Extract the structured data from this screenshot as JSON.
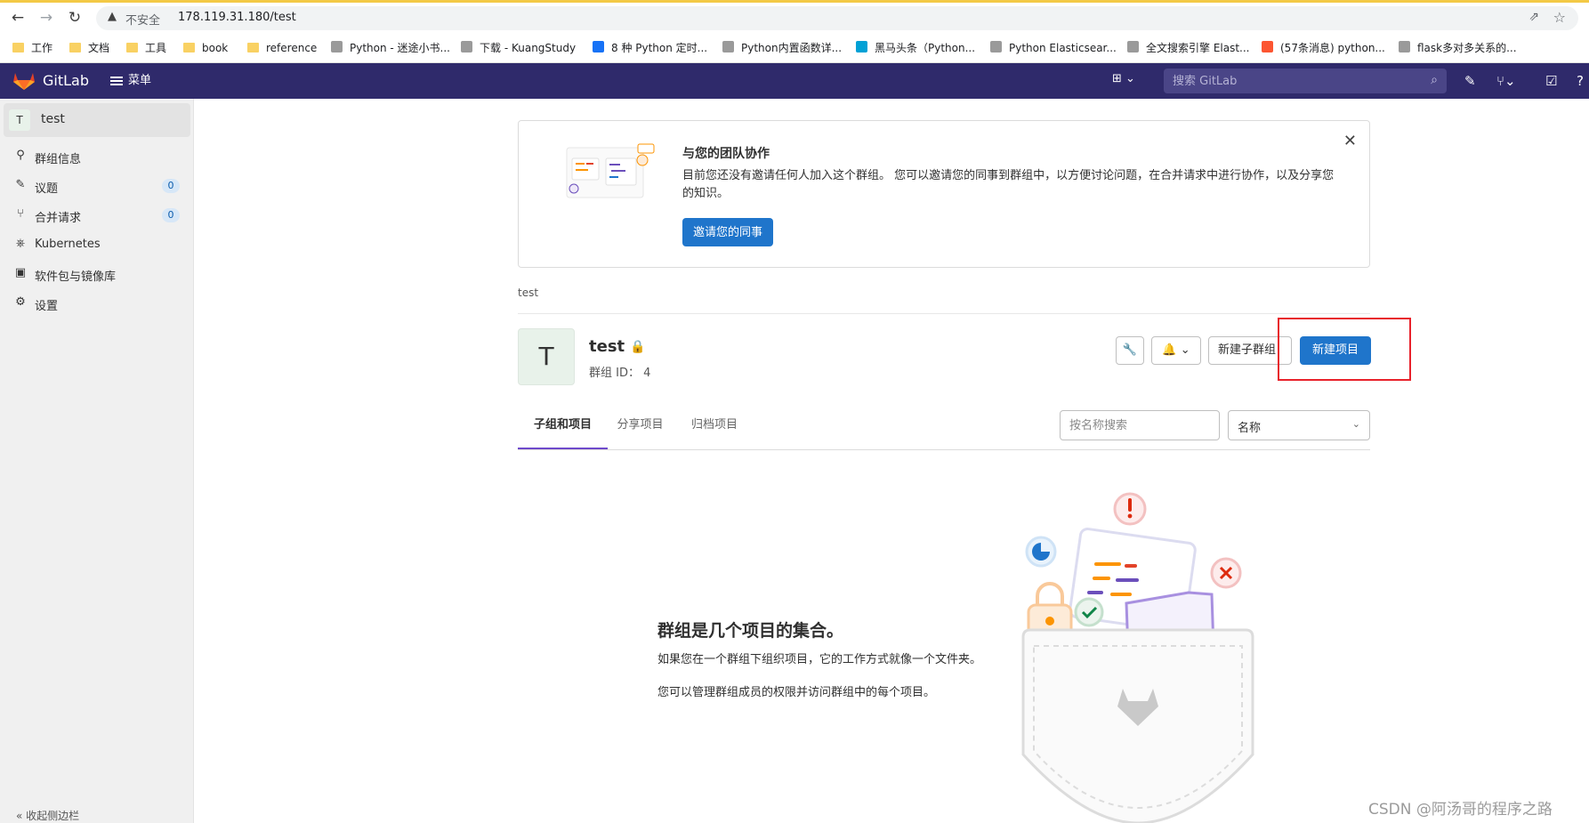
{
  "browser": {
    "security_label": "不安全",
    "url": "178.119.31.180/test",
    "bookmarks": [
      {
        "label": "工作",
        "icon": "folder-icon"
      },
      {
        "label": "文档",
        "icon": "folder-icon"
      },
      {
        "label": "工具",
        "icon": "folder-icon"
      },
      {
        "label": "book",
        "icon": "folder-icon"
      },
      {
        "label": "reference",
        "icon": "folder-icon"
      },
      {
        "label": "Python - 迷途小书...",
        "icon": "site-icon"
      },
      {
        "label": "下载 - KuangStudy",
        "icon": "site-icon"
      },
      {
        "label": "8 种 Python 定时...",
        "icon": "zhihu-icon"
      },
      {
        "label": "Python内置函数详...",
        "icon": "site-icon"
      },
      {
        "label": "黑马头条（Python...",
        "icon": "bilibili-icon"
      },
      {
        "label": "Python Elasticsear...",
        "icon": "site-icon"
      },
      {
        "label": "全文搜索引擎 Elast...",
        "icon": "site-icon"
      },
      {
        "label": "(57条消息) python...",
        "icon": "csdn-icon"
      },
      {
        "label": "flask多对多关系的...",
        "icon": "site-icon"
      }
    ]
  },
  "header": {
    "brand": "GitLab",
    "menu_label": "菜单",
    "search_placeholder": "搜索 GitLab"
  },
  "sidebar": {
    "context_avatar": "T",
    "context_name": "test",
    "items": [
      {
        "label": "群组信息",
        "icon": "group-info-icon",
        "count": null
      },
      {
        "label": "议题",
        "icon": "issues-icon",
        "count": "0"
      },
      {
        "label": "合并请求",
        "icon": "merge-request-icon",
        "count": "0"
      },
      {
        "label": "Kubernetes",
        "icon": "kubernetes-icon",
        "count": null
      },
      {
        "label": "软件包与镜像库",
        "icon": "package-icon",
        "count": null
      },
      {
        "label": "设置",
        "icon": "settings-icon",
        "count": null
      }
    ],
    "collapse_label": "« 收起侧边栏"
  },
  "invite": {
    "title": "与您的团队协作",
    "body": "目前您还没有邀请任何人加入这个群组。 您可以邀请您的同事到群组中，以方便讨论问题，在合并请求中进行协作，以及分享您的知识。",
    "button": "邀请您的同事"
  },
  "breadcrumb": "test",
  "group": {
    "avatar": "T",
    "name": "test",
    "id_label": "群组 ID： 4",
    "new_subgroup_label": "新建子群组",
    "new_project_label": "新建项目"
  },
  "tabs": [
    {
      "label": "子组和项目",
      "active": true
    },
    {
      "label": "分享项目",
      "active": false
    },
    {
      "label": "归档项目",
      "active": false
    }
  ],
  "filter": {
    "placeholder": "按名称搜索",
    "sort_value": "名称"
  },
  "empty_state": {
    "title": "群组是几个项目的集合。",
    "line1": "如果您在一个群组下组织项目，它的工作方式就像一个文件夹。",
    "line2": "您可以管理群组成员的权限并访问群组中的每个项目。"
  },
  "watermark": "CSDN @阿汤哥的程序之路",
  "colors": {
    "header_bg": "#2f2a6b",
    "primary": "#1f75cb",
    "tab_active": "#6e49cb",
    "highlight": "#e8222b"
  }
}
